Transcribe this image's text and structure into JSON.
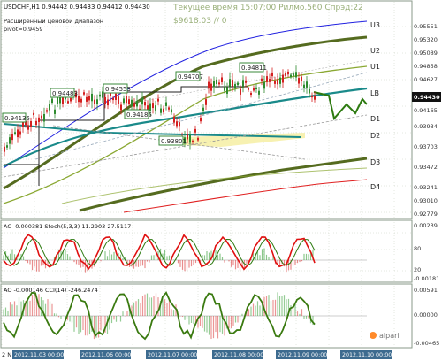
{
  "header": {
    "symbol_line": "USDCHF,H1  0.94442  0.94433  0.94412  0.94430",
    "server_time": "Текущее время 15:07:00 Рилмо.560 Спрэд:22",
    "balance_line": "$9618.03    // 0",
    "pivot_title": "Расширенный ценовой диапазон",
    "pivot_value": "pivot=0.9459"
  },
  "levels": [
    "U3",
    "U2",
    "U1",
    "LB",
    "D1",
    "D2",
    "D3",
    "D4"
  ],
  "price_axis": [
    "0.95551",
    "0.95320",
    "0.95089",
    "0.94858",
    "0.94627",
    "0.94430",
    "0.94165",
    "0.93934",
    "0.93703",
    "0.93472",
    "0.93241",
    "0.93010",
    "0.92779"
  ],
  "current_price": "0.94430",
  "price_tags": [
    "0.94135",
    "0.94483",
    "0.94553",
    "0.94185",
    "0.94707",
    "0.93801",
    "0.94811"
  ],
  "ac_panel": {
    "label": "AC  -0.000381  Stoch(5,3,3)  11.2903  27.5117",
    "axis": [
      "0.00239",
      "80",
      "20",
      "-0.00181"
    ]
  },
  "ao_panel": {
    "label": "AO  -0.000146  CCI(14)  -246.2474",
    "axis": [
      "0.00591",
      "0.00000",
      "-0.00465"
    ]
  },
  "time_axis": [
    "2 N",
    "2012.11.03 00:00",
    "2012.11.06 00:00",
    "2012.11.07 00:00",
    "2012.11.08 00:00",
    "2012.11.09 00:00",
    "2012.11.10 00:00"
  ],
  "watermark": "alpari",
  "colors": {
    "background": "#ffffff",
    "grid": "#c8d0c0",
    "candle_up": "#2e8b2e",
    "candle_down": "#d42020",
    "channel_outer": "#556b1f",
    "channel_mid": "#8aa832",
    "teal_line": "#1a8a8a",
    "top_curve": "#2020e0",
    "bottom_curve": "#e02020",
    "zone_fill": "#f5f0a0",
    "label_border": "#3a8a3a",
    "ac_line_red": "#e01010",
    "ac_line_green": "#2d7a10"
  }
}
